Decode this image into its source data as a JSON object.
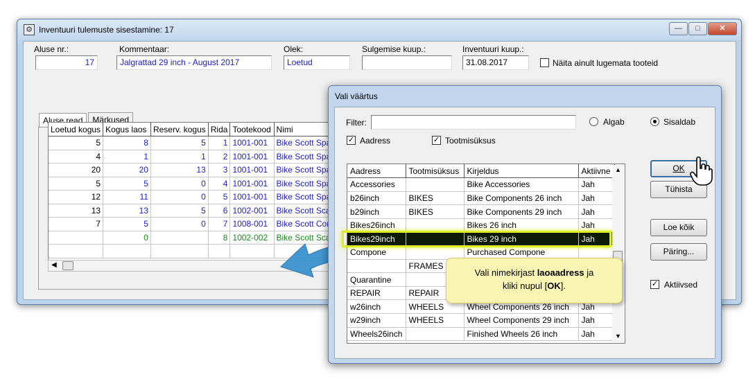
{
  "main_window": {
    "title": "Inventuuri tulemuste sisestamine: 17",
    "fields": {
      "aluse_nr_label": "Aluse nr.:",
      "aluse_nr_value": "17",
      "kommentaar_label": "Kommentaar:",
      "kommentaar_value": "Jalgrattad 29 inch - August 2017",
      "olek_label": "Olek:",
      "olek_value": "Loetud",
      "sulgemise_label": "Sulgemise kuup.:",
      "sulgemise_value": "",
      "inventuuri_label": "Inventuuri kuup.:",
      "inventuuri_value": "31.08.2017",
      "naita_label": "Näita ainult lugemata tooteid"
    },
    "tabs": [
      {
        "label": "Aluse read"
      },
      {
        "label": "Märkused"
      }
    ],
    "grid": {
      "headers": [
        "Loetud kogus",
        "Kogus laos",
        "Reserv. kogus",
        "Rida",
        "Tootekood",
        "Nimi"
      ],
      "rows": [
        {
          "loetud": "5",
          "kogus": "8",
          "reserv": "5",
          "rida": "1",
          "kood": "1001-001",
          "nimi": "Bike Scott Spa"
        },
        {
          "loetud": "4",
          "kogus": "1",
          "reserv": "1",
          "rida": "2",
          "kood": "1001-001",
          "nimi": "Bike Scott Spa"
        },
        {
          "loetud": "20",
          "kogus": "20",
          "reserv": "13",
          "rida": "3",
          "kood": "1001-001",
          "nimi": "Bike Scott Spa"
        },
        {
          "loetud": "5",
          "kogus": "5",
          "reserv": "0",
          "rida": "4",
          "kood": "1001-001",
          "nimi": "Bike Scott Spa"
        },
        {
          "loetud": "12",
          "kogus": "11",
          "reserv": "0",
          "rida": "5",
          "kood": "1001-001",
          "nimi": "Bike Scott Spa"
        },
        {
          "loetud": "13",
          "kogus": "13",
          "reserv": "5",
          "rida": "6",
          "kood": "1002-001",
          "nimi": "Bike Scott Sca"
        },
        {
          "loetud": "7",
          "kogus": "5",
          "reserv": "0",
          "rida": "7",
          "kood": "1008-001",
          "nimi": "Bike Scott Con"
        },
        {
          "loetud": "",
          "kogus": "0",
          "reserv": "",
          "rida": "8",
          "kood": "1002-002",
          "nimi": "Bike Scott Sca"
        }
      ]
    }
  },
  "dialog": {
    "title": "Vali väärtus",
    "filter_label": "Filter:",
    "filter_value": "",
    "algab_label": "Algab",
    "sisaldab_label": "Sisaldab",
    "aadress_label": "Aadress",
    "tootmisuksus_label": "Tootmisüksus",
    "list": {
      "headers": [
        "Aadress",
        "Tootmisüksus",
        "Kirjeldus",
        "Aktiivne"
      ],
      "rows": [
        {
          "aadress": "Accessories",
          "tootmis": "",
          "kirjeldus": "Bike Accessories",
          "aktiivne": "Jah"
        },
        {
          "aadress": "b26inch",
          "tootmis": "BIKES",
          "kirjeldus": "Bike Components 26 inch",
          "aktiivne": "Jah"
        },
        {
          "aadress": "b29inch",
          "tootmis": "BIKES",
          "kirjeldus": "Bike Components 29 inch",
          "aktiivne": "Jah"
        },
        {
          "aadress": "Bikes26inch",
          "tootmis": "",
          "kirjeldus": "Bikes 26 inch",
          "aktiivne": "Jah"
        },
        {
          "aadress": "Bikes29inch",
          "tootmis": "",
          "kirjeldus": "Bikes 29 inch",
          "aktiivne": "Jah"
        },
        {
          "aadress": "Compone",
          "tootmis": "",
          "kirjeldus": "Purchased Compone",
          "aktiivne": ""
        },
        {
          "aadress": "",
          "tootmis": "FRAMES",
          "kirjeldus": "",
          "aktiivne": ""
        },
        {
          "aadress": "Quarantine",
          "tootmis": "",
          "kirjeldus": "",
          "aktiivne": ""
        },
        {
          "aadress": "REPAIR",
          "tootmis": "REPAIR",
          "kirjeldus": "",
          "aktiivne": ""
        },
        {
          "aadress": "w26inch",
          "tootmis": "WHEELS",
          "kirjeldus": "Wheel Components 26 inch",
          "aktiivne": "Jah"
        },
        {
          "aadress": "w29inch",
          "tootmis": "WHEELS",
          "kirjeldus": "Wheel Components 29 inch",
          "aktiivne": "Jah"
        },
        {
          "aadress": "Wheels26inch",
          "tootmis": "",
          "kirjeldus": "Finished Wheels 26 inch",
          "aktiivne": "Jah"
        }
      ]
    },
    "buttons": {
      "ok": "OK",
      "tuhista": "Tühista",
      "loe_koik": "Loe kõik",
      "paring": "Päring..."
    },
    "aktiivsed_label": "Aktiivsed"
  },
  "callout": {
    "line1_prefix": "Vali nimekirjast ",
    "line1_bold": "laoaadress",
    "line1_suffix": " ja",
    "line2_prefix": "kliki nupul [",
    "line2_bold": "OK",
    "line2_suffix": "]."
  },
  "colors": {
    "highlight": "#ddee22",
    "arrow": "#3b93d0",
    "callout_bg": "#fbf5b4",
    "selected_row": "#0d1a08"
  }
}
